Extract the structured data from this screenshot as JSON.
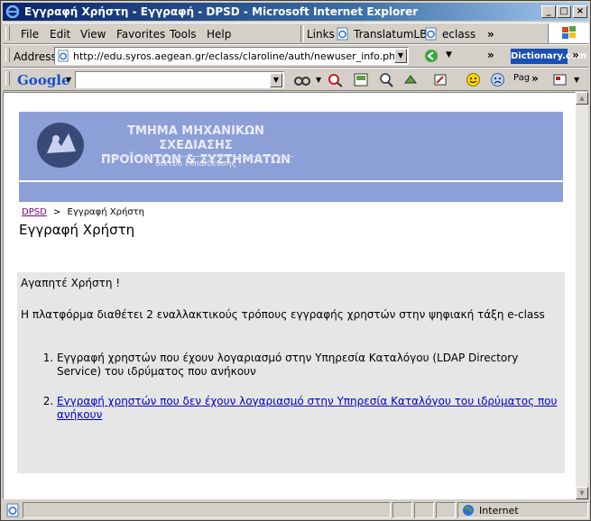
{
  "window": {
    "title": "Εγγραφή Χρήστη - Εγγραφή - DPSD - Microsoft Internet Explorer"
  },
  "menu": [
    "File",
    "Edit",
    "View",
    "Favorites",
    "Tools",
    "Help"
  ],
  "links": {
    "label": "Links",
    "items": [
      "TranslatumLB",
      "eclass"
    ],
    "more": "»"
  },
  "address": {
    "label": "Address",
    "url": "http://edu.syros.aegean.gr/eclass/claroline/auth/newuser_info.php",
    "dictionary": "Dictionary.com"
  },
  "google": {
    "logo": "Google",
    "search_value": "",
    "page_label": "Pag"
  },
  "banner": {
    "line1": "ΤΜΗΜΑ ΜΗΧΑΝΙΚΩΝ ΣΧΕΔΙΑΣΗΣ",
    "line2": "ΠΡΟΪΟΝΤΩΝ & ΣΥΣΤΗΜΑΤΩΝ",
    "line3": "δίκτυο εκπαίδευσης"
  },
  "breadcrumb": {
    "root": "DPSD",
    "sep": ">",
    "current": "Εγγραφή Χρήστη"
  },
  "page": {
    "title": "Εγγραφή Χρήστη",
    "greeting": "Αγαπητέ Χρήστη !",
    "intro": "Η πλατφόρμα διαθέτει 2 εναλλακτικούς τρόπους εγγραφής χρηστών στην ψηφιακή τάξη e-class",
    "options": [
      "Εγγραφή χρηστών που έχουν λογαριασμό στην Υπηρεσία Καταλόγου (LDAP Directory Service) του ιδρύματος που ανήκουν",
      "Εγγραφή χρηστών που δεν έχουν λογαριασμό στην Υπηρεσία Καταλόγου του ιδρύματος που ανήκουν"
    ]
  },
  "status": {
    "zone": "Internet"
  },
  "colors": {
    "banner": "#8c9fd6",
    "title_bar": "#0a246a",
    "link": "#0000cc",
    "visited": "#800080"
  }
}
